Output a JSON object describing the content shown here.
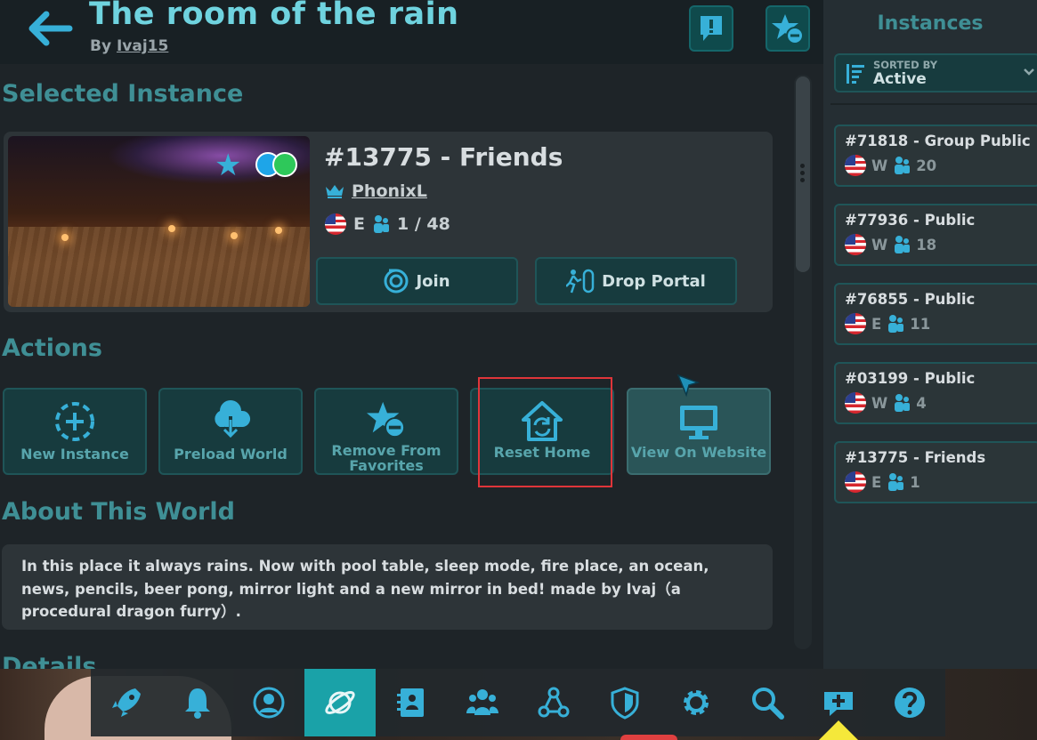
{
  "header": {
    "title": "The room of the rain",
    "by_prefix": "By",
    "author": "Ivaj15"
  },
  "selected_instance": {
    "section_title": "Selected Instance",
    "name": "#13775 - Friends",
    "owner": "PhonixL",
    "region": "E",
    "users": "1 / 48",
    "join_label": "Join",
    "drop_portal_label": "Drop Portal"
  },
  "actions": {
    "section_title": "Actions",
    "items": [
      {
        "label": "New Instance",
        "icon": "add-dashed-circle-icon"
      },
      {
        "label": "Preload World",
        "icon": "cloud-download-icon"
      },
      {
        "label": "Remove From Favorites",
        "icon": "star-minus-icon"
      },
      {
        "label": "Reset Home",
        "icon": "home-reset-icon"
      },
      {
        "label": "View On Website",
        "icon": "monitor-icon"
      }
    ]
  },
  "about": {
    "section_title": "About This World",
    "description": "In this place it always rains. Now with pool table, sleep mode, fire place, an ocean, news, pencils, beer pong, mirror light and a new mirror in bed! made by Ivaj（a procedural dragon furry）.",
    "next_section": "Details"
  },
  "instances_panel": {
    "title": "Instances",
    "sorted_by_label": "SORTED BY",
    "sorted_by_value": "Active",
    "items": [
      {
        "name": "#71818 - Group Public",
        "region": "W",
        "count": "20"
      },
      {
        "name": "#77936 - Public",
        "region": "W",
        "count": "18"
      },
      {
        "name": "#76855 - Public",
        "region": "E",
        "count": "11"
      },
      {
        "name": "#03199 - Public",
        "region": "W",
        "count": "4"
      },
      {
        "name": "#13775 - Friends",
        "region": "E",
        "count": "1"
      }
    ]
  },
  "nav": {
    "items": [
      "rocket-icon",
      "bell-icon",
      "profile-icon",
      "planet-icon",
      "social-icon",
      "group-icon",
      "network-icon",
      "shield-icon",
      "gear-icon",
      "search-icon",
      "chat-add-icon",
      "help-icon"
    ],
    "active": "planet-icon"
  },
  "colors": {
    "accent": "#6fd3df",
    "section_title": "#3f8f95",
    "button_bg": "#173b3e",
    "active_nav": "#1aa2a8",
    "highlight": "#e0353a"
  }
}
